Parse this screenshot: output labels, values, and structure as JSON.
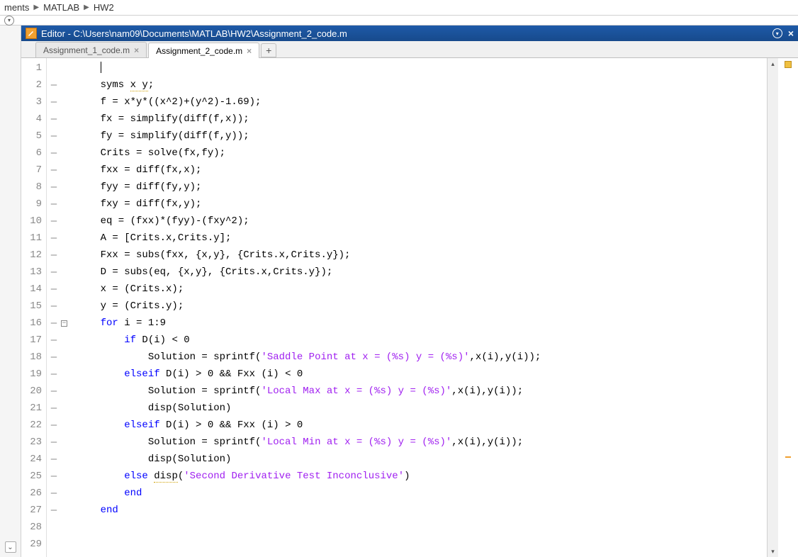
{
  "breadcrumb": {
    "items": [
      "ments",
      "MATLAB",
      "HW2"
    ]
  },
  "editor": {
    "title": "Editor - C:\\Users\\nam09\\Documents\\MATLAB\\HW2\\Assignment_2_code.m",
    "tabs": [
      {
        "label": "Assignment_1_code.m",
        "active": false
      },
      {
        "label": "Assignment_2_code.m",
        "active": true
      }
    ],
    "lines": [
      {
        "n": 1,
        "mark": "",
        "fold": "",
        "segs": [
          {
            "t": "",
            "c": ""
          }
        ]
      },
      {
        "n": 2,
        "mark": "–",
        "fold": "",
        "segs": [
          {
            "t": "syms ",
            "c": ""
          },
          {
            "t": "x y",
            "c": "dotted"
          },
          {
            "t": ";",
            "c": ""
          }
        ]
      },
      {
        "n": 3,
        "mark": "–",
        "fold": "",
        "segs": [
          {
            "t": "f = x*y*((x^2)+(y^2)-1.69);",
            "c": ""
          }
        ]
      },
      {
        "n": 4,
        "mark": "–",
        "fold": "",
        "segs": [
          {
            "t": "fx = simplify(diff(f,x));",
            "c": ""
          }
        ]
      },
      {
        "n": 5,
        "mark": "–",
        "fold": "",
        "segs": [
          {
            "t": "fy = simplify(diff(f,y));",
            "c": ""
          }
        ]
      },
      {
        "n": 6,
        "mark": "–",
        "fold": "",
        "segs": [
          {
            "t": "Crits = solve(fx,fy);",
            "c": ""
          }
        ]
      },
      {
        "n": 7,
        "mark": "–",
        "fold": "",
        "segs": [
          {
            "t": "fxx = diff(fx,x);",
            "c": ""
          }
        ]
      },
      {
        "n": 8,
        "mark": "–",
        "fold": "",
        "segs": [
          {
            "t": "fyy = diff(fy,y);",
            "c": ""
          }
        ]
      },
      {
        "n": 9,
        "mark": "–",
        "fold": "",
        "segs": [
          {
            "t": "fxy = diff(fx,y);",
            "c": ""
          }
        ]
      },
      {
        "n": 10,
        "mark": "–",
        "fold": "",
        "segs": [
          {
            "t": "eq = (fxx)*(fyy)-(fxy^2);",
            "c": ""
          }
        ]
      },
      {
        "n": 11,
        "mark": "–",
        "fold": "",
        "segs": [
          {
            "t": "A = [Crits.x,Crits.y];",
            "c": ""
          }
        ]
      },
      {
        "n": 12,
        "mark": "–",
        "fold": "",
        "segs": [
          {
            "t": "Fxx = subs(fxx, {x,y}, {Crits.x,Crits.y});",
            "c": ""
          }
        ]
      },
      {
        "n": 13,
        "mark": "–",
        "fold": "",
        "segs": [
          {
            "t": "D = subs(eq, {x,y}, {Crits.x,Crits.y});",
            "c": ""
          }
        ]
      },
      {
        "n": 14,
        "mark": "–",
        "fold": "",
        "segs": [
          {
            "t": "x = (Crits.x);",
            "c": ""
          }
        ]
      },
      {
        "n": 15,
        "mark": "–",
        "fold": "",
        "segs": [
          {
            "t": "y = (Crits.y);",
            "c": ""
          }
        ]
      },
      {
        "n": 16,
        "mark": "–",
        "fold": "⊟",
        "segs": [
          {
            "t": "for",
            "c": "kw"
          },
          {
            "t": " i = 1:9",
            "c": ""
          }
        ]
      },
      {
        "n": 17,
        "mark": "–",
        "fold": "",
        "indent": 1,
        "segs": [
          {
            "t": "if",
            "c": "kw"
          },
          {
            "t": " D(i) < 0",
            "c": ""
          }
        ]
      },
      {
        "n": 18,
        "mark": "–",
        "fold": "",
        "indent": 2,
        "segs": [
          {
            "t": "Solution = sprintf(",
            "c": ""
          },
          {
            "t": "'Saddle Point at x = (%s) y = (%s)'",
            "c": "str"
          },
          {
            "t": ",x(i),y(i));",
            "c": ""
          }
        ]
      },
      {
        "n": 19,
        "mark": "–",
        "fold": "",
        "indent": 1,
        "segs": [
          {
            "t": "elseif",
            "c": "kw"
          },
          {
            "t": " D(i) > 0 && Fxx (i) < 0",
            "c": ""
          }
        ]
      },
      {
        "n": 20,
        "mark": "–",
        "fold": "",
        "indent": 2,
        "segs": [
          {
            "t": "Solution = sprintf(",
            "c": ""
          },
          {
            "t": "'Local Max at x = (%s) y = (%s)'",
            "c": "str"
          },
          {
            "t": ",x(i),y(i));",
            "c": ""
          }
        ]
      },
      {
        "n": 21,
        "mark": "–",
        "fold": "",
        "indent": 2,
        "segs": [
          {
            "t": "disp(Solution)",
            "c": ""
          }
        ]
      },
      {
        "n": 22,
        "mark": "–",
        "fold": "",
        "indent": 1,
        "segs": [
          {
            "t": "elseif",
            "c": "kw"
          },
          {
            "t": " D(i) > 0 && Fxx (i) > 0",
            "c": ""
          }
        ]
      },
      {
        "n": 23,
        "mark": "–",
        "fold": "",
        "indent": 2,
        "segs": [
          {
            "t": "Solution = sprintf(",
            "c": ""
          },
          {
            "t": "'Local Min at x = (%s) y = (%s)'",
            "c": "str"
          },
          {
            "t": ",x(i),y(i));",
            "c": ""
          }
        ]
      },
      {
        "n": 24,
        "mark": "–",
        "fold": "",
        "indent": 2,
        "segs": [
          {
            "t": "disp(Solution)",
            "c": ""
          }
        ]
      },
      {
        "n": 25,
        "mark": "–",
        "fold": "",
        "indent": 1,
        "segs": [
          {
            "t": "else",
            "c": "kw"
          },
          {
            "t": " ",
            "c": ""
          },
          {
            "t": "disp",
            "c": "dotted"
          },
          {
            "t": "(",
            "c": ""
          },
          {
            "t": "'Second Derivative Test Inconclusive'",
            "c": "str"
          },
          {
            "t": ")",
            "c": ""
          }
        ]
      },
      {
        "n": 26,
        "mark": "–",
        "fold": "",
        "indent": 1,
        "segs": [
          {
            "t": "end",
            "c": "kw"
          }
        ]
      },
      {
        "n": 27,
        "mark": "–",
        "fold": "",
        "segs": [
          {
            "t": "end",
            "c": "kw"
          }
        ]
      },
      {
        "n": 28,
        "mark": "",
        "fold": "",
        "segs": [
          {
            "t": "",
            "c": ""
          }
        ]
      },
      {
        "n": 29,
        "mark": "",
        "fold": "",
        "segs": [
          {
            "t": "",
            "c": ""
          }
        ]
      }
    ]
  }
}
